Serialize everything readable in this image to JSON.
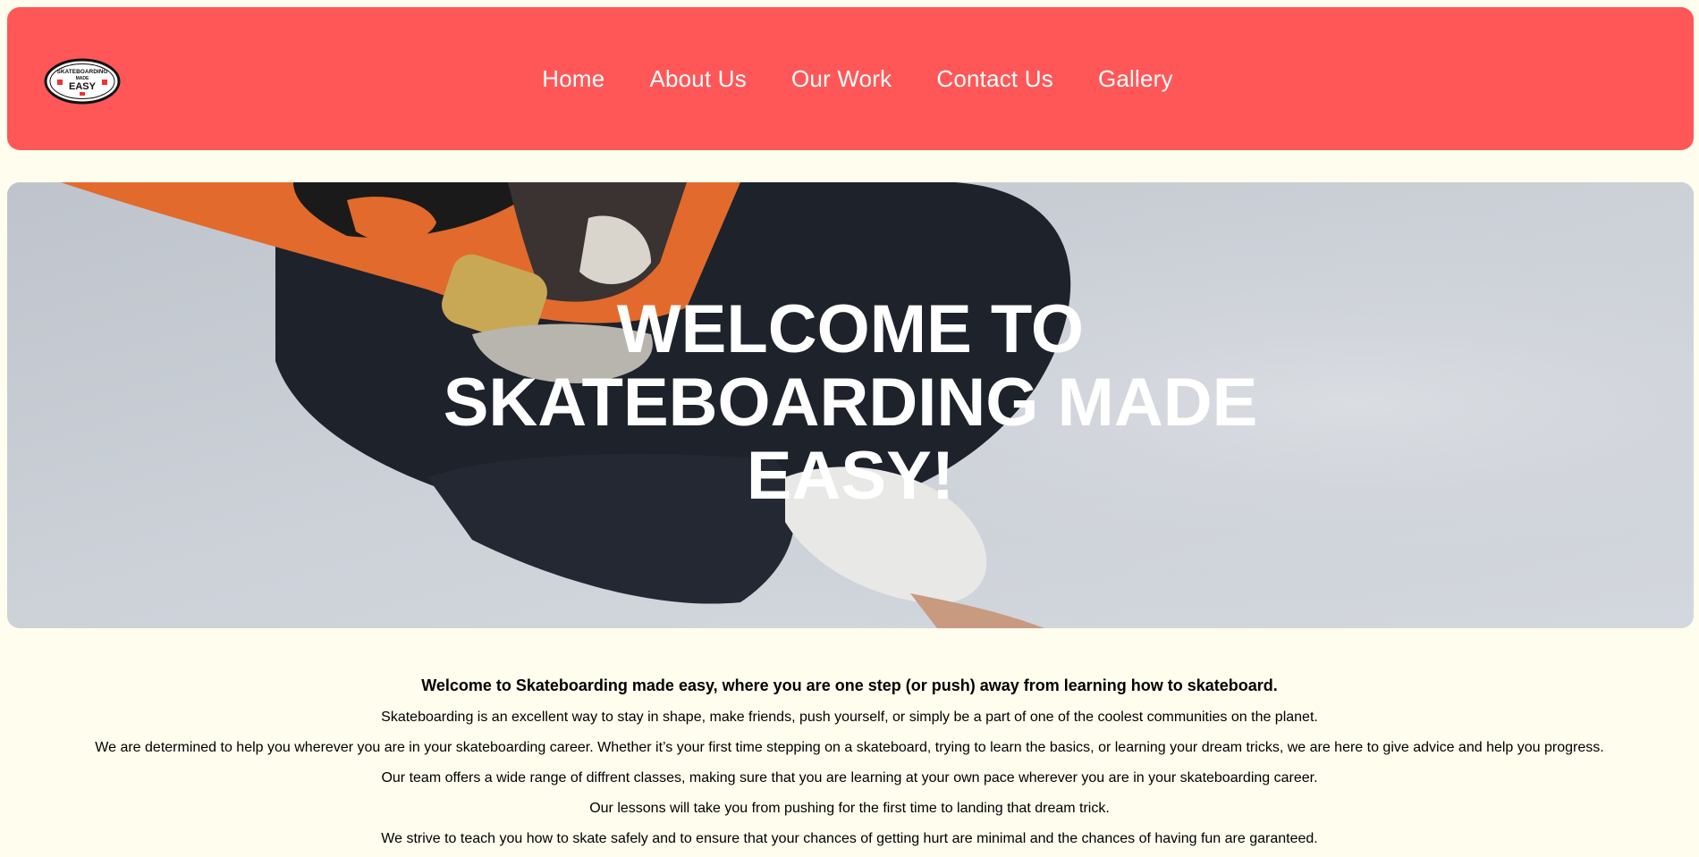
{
  "logo": {
    "line1": "SKATEBOARDING",
    "line2": "MADE",
    "line3": "EASY"
  },
  "nav": {
    "items": [
      {
        "label": "Home"
      },
      {
        "label": "About Us"
      },
      {
        "label": "Our Work"
      },
      {
        "label": "Contact Us"
      },
      {
        "label": "Gallery"
      }
    ]
  },
  "hero": {
    "title_line1": "WELCOME TO",
    "title_line2": "SKATEBOARDING MADE",
    "title_line3": "EASY!"
  },
  "intro": {
    "lead": "Welcome to Skateboarding made easy, where you are one step (or push) away from learning how to skateboard.",
    "paragraphs": [
      "Skateboarding is an excellent way to stay in shape, make friends, push yourself, or simply be a part of one of the coolest communities on the planet.",
      "We are determined to help you wherever you are in your skateboarding career. Whether it’s your first time stepping on a skateboard, trying to learn the basics, or learning your dream tricks, we are here to give advice and help you progress.",
      "Our team offers a wide range of diffrent classes, making sure that you are learning at your own pace wherever you are in your skateboarding career.",
      "Our lessons will take you from pushing for the first time to landing that dream trick.",
      "We strive to teach you how to skate safely and to ensure that your chances of getting hurt are minimal and the chances of having fun are garanteed."
    ]
  },
  "colors": {
    "header_bg": "#ff5757",
    "page_bg": "#fffdee",
    "nav_text": "#ffffff",
    "hero_text": "#ffffff"
  }
}
